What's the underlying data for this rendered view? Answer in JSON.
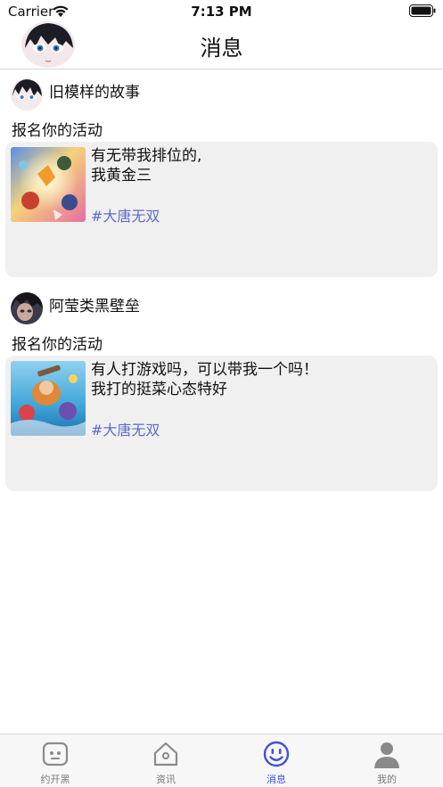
{
  "status_bar": {
    "carrier": "Carrier",
    "time": "7:13 PM"
  },
  "nav": {
    "title": "消息"
  },
  "messages": [
    {
      "user": "旧模样的故事",
      "action": "报名你的活动",
      "text": "有无带我排位的,\n我黄金三",
      "tag": "#大唐无双"
    },
    {
      "user": "阿莹类黑壁垒",
      "action": "报名你的活动",
      "text": "有人打游戏吗，可以带我一个吗！\n我打的挺菜心态特好",
      "tag": "#大唐无双"
    }
  ],
  "tabs": [
    {
      "label": "约开黑",
      "icon": "robot-face-icon"
    },
    {
      "label": "资讯",
      "icon": "home-icon"
    },
    {
      "label": "消息",
      "icon": "smile-face-icon"
    },
    {
      "label": "我的",
      "icon": "person-icon"
    }
  ],
  "colors": {
    "accent": "#3f51d8",
    "tag": "#5d6bc9",
    "card_bg": "#f0f0f0"
  }
}
